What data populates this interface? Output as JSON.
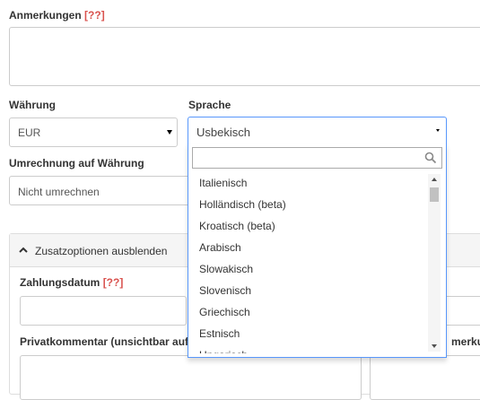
{
  "anmerkungen": {
    "label": "Anmerkungen",
    "marker": "[??]"
  },
  "waehrung": {
    "label": "Währung",
    "value": "EUR"
  },
  "sprache": {
    "label": "Sprache",
    "value": "Usbekisch"
  },
  "umrechnung": {
    "label": "Umrechnung auf Währung",
    "value": "Nicht umrechnen"
  },
  "panel": {
    "toggle_label": "Zusatzoptionen ausblenden"
  },
  "zahlungsdatum": {
    "label": "Zahlungsdatum",
    "marker": "[??]"
  },
  "privatkommentar": {
    "label": "Privatkommentar (unsichtbar auf",
    "right_label_fragment": "merku"
  },
  "dropdown": {
    "search_placeholder": "",
    "options": [
      "Italienisch",
      "Holländisch (beta)",
      "Kroatisch (beta)",
      "Arabisch",
      "Slowakisch",
      "Slovenisch",
      "Griechisch",
      "Estnisch",
      "Ungarisch"
    ]
  },
  "colors": {
    "required_marker": "#d9534f",
    "focus_border": "#5897fb"
  },
  "icons": {
    "search": "search-icon",
    "select_caret": "caret-down-icon",
    "panel_toggle": "chevron-up-icon"
  }
}
